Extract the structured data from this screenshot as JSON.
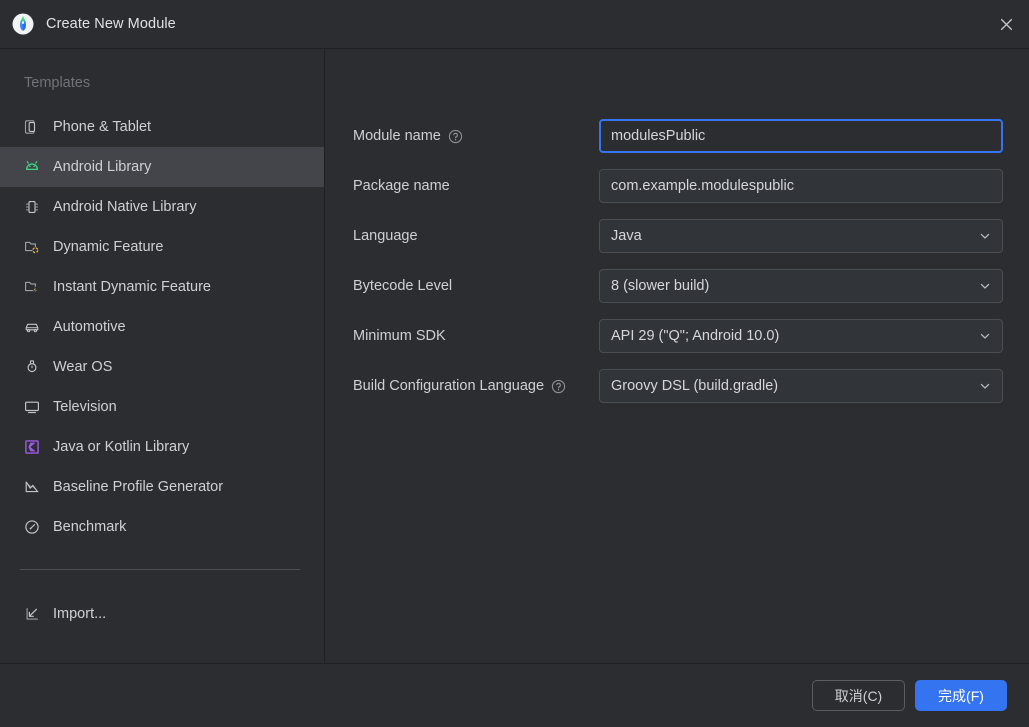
{
  "window": {
    "title": "Create New Module",
    "app_icon": "android-studio-icon",
    "close_icon": "close-icon"
  },
  "sidebar": {
    "header": "Templates",
    "items": [
      {
        "label": "Phone & Tablet",
        "icon": "phone-tablet-icon",
        "selected": false
      },
      {
        "label": "Android Library",
        "icon": "android-head-icon",
        "selected": true
      },
      {
        "label": "Android Native Library",
        "icon": "chip-icon",
        "selected": false
      },
      {
        "label": "Dynamic Feature",
        "icon": "folder-dynamic-icon",
        "selected": false
      },
      {
        "label": "Instant Dynamic Feature",
        "icon": "folder-instant-icon",
        "selected": false
      },
      {
        "label": "Automotive",
        "icon": "car-icon",
        "selected": false
      },
      {
        "label": "Wear OS",
        "icon": "watch-icon",
        "selected": false
      },
      {
        "label": "Television",
        "icon": "television-icon",
        "selected": false
      },
      {
        "label": "Java or Kotlin Library",
        "icon": "kotlin-library-icon",
        "selected": false
      },
      {
        "label": "Baseline Profile Generator",
        "icon": "baseline-profile-icon",
        "selected": false
      },
      {
        "label": "Benchmark",
        "icon": "benchmark-gauge-icon",
        "selected": false
      }
    ],
    "import": {
      "label": "Import...",
      "icon": "import-arrow-icon"
    }
  },
  "form": {
    "fields": [
      {
        "label": "Module name",
        "value": "modulesPublic",
        "type": "text",
        "focused": true,
        "help": true,
        "help_icon": "question-circle-icon",
        "name": "module-name"
      },
      {
        "label": "Package name",
        "value": "com.example.modulespublic",
        "type": "text",
        "focused": false,
        "help": false,
        "name": "package-name"
      },
      {
        "label": "Language",
        "value": "Java",
        "type": "select",
        "focused": false,
        "help": false,
        "name": "language"
      },
      {
        "label": "Bytecode Level",
        "value": "8 (slower build)",
        "type": "select",
        "focused": false,
        "help": false,
        "name": "bytecode-level"
      },
      {
        "label": "Minimum SDK",
        "value": "API 29 (\"Q\"; Android 10.0)",
        "type": "select",
        "focused": false,
        "help": false,
        "name": "minimum-sdk"
      },
      {
        "label": "Build Configuration Language",
        "value": "Groovy DSL (build.gradle)",
        "type": "select",
        "focused": false,
        "help": true,
        "help_icon": "question-circle-icon",
        "name": "build-configuration-language"
      }
    ]
  },
  "footer": {
    "cancel_label": "取消(C)",
    "finish_label": "完成(F)"
  },
  "colors": {
    "background": "#2b2d30",
    "selected_row": "#43454a",
    "accent_blue": "#3574f0",
    "android_green": "#3ddc84",
    "kotlin_purple": "#9b5de5",
    "instant_yellow": "#e8b33a",
    "text_primary": "#ced0d6",
    "text_muted": "#6f737a",
    "border": "#4a4d51"
  }
}
